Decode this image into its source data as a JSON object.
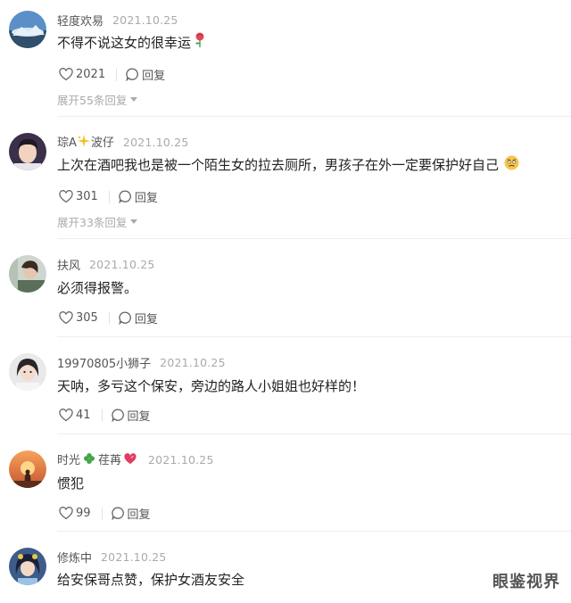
{
  "comments": [
    {
      "username": "轻度欢易",
      "date": "2021.10.25",
      "text": "不得不说这女的很幸运",
      "emoji": "rose-icon",
      "likes": "2021",
      "reply_label": "回复",
      "expand_label": "展开55条回复"
    },
    {
      "username_part1": "琮A",
      "username_part2": "波仔",
      "username_emoji": "sparkles-icon",
      "date": "2021.10.25",
      "text": "上次在酒吧我也是被一个陌生女的拉去厕所，男孩子在外一定要保护好自己",
      "emoji": "worried-face-icon",
      "likes": "301",
      "reply_label": "回复",
      "expand_label": "展开33条回复"
    },
    {
      "username": "扶风",
      "date": "2021.10.25",
      "text": "必须得报警。",
      "likes": "305",
      "reply_label": "回复"
    },
    {
      "username": "19970805小狮子",
      "date": "2021.10.25",
      "text": "天呐，多亏这个保安，旁边的路人小姐姐也好样的！",
      "likes": "41",
      "reply_label": "回复"
    },
    {
      "username_part1": "时光",
      "username_part2": "荏苒",
      "username_emoji": "clover-icon",
      "username_emoji2": "heart-icon",
      "date": "2021.10.25",
      "text": "惯犯",
      "likes": "99",
      "reply_label": "回复"
    },
    {
      "username": "修炼中",
      "date": "2021.10.25",
      "text": "给安保哥点赞，保护女酒友安全"
    }
  ],
  "watermark": "眼鉴视界",
  "colors": {
    "username": "#555555",
    "date": "#aaaaaa",
    "text": "#222222",
    "divider": "#eeeeee"
  }
}
